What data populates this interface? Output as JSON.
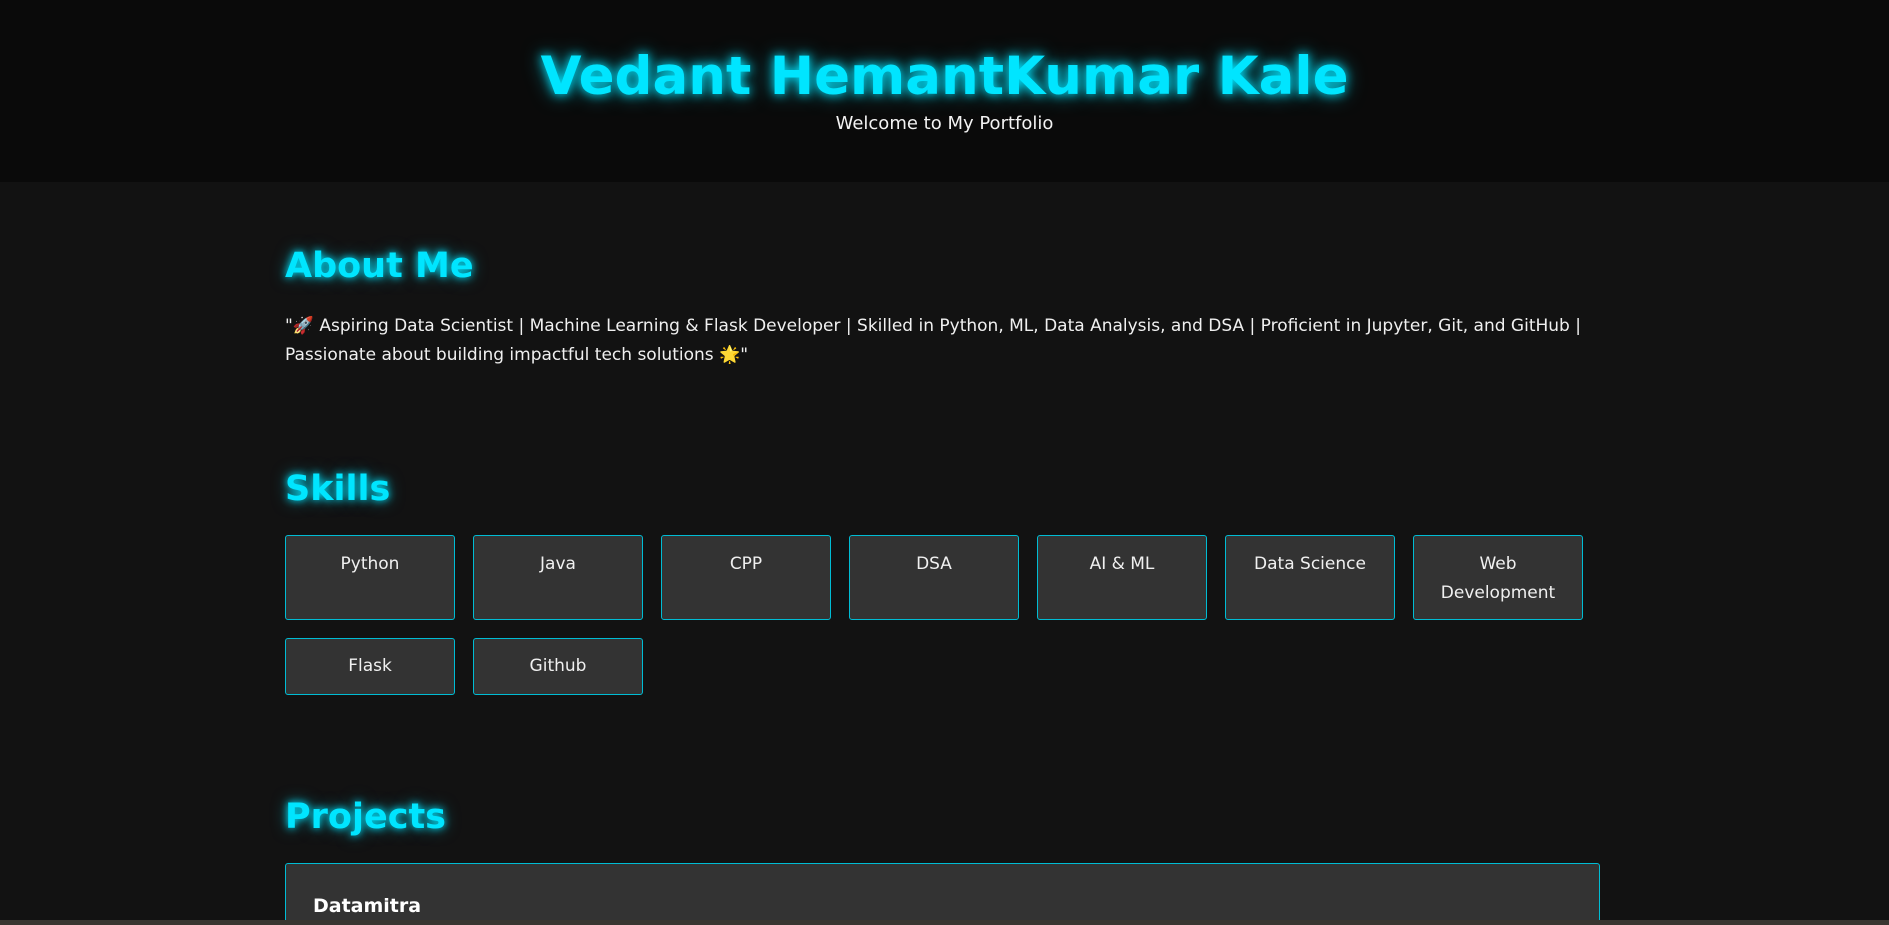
{
  "header": {
    "title": "Vedant HemantKumar Kale",
    "subtitle": "Welcome to My Portfolio"
  },
  "about": {
    "heading": "About Me",
    "text": "\"🚀 Aspiring Data Scientist | Machine Learning & Flask Developer | Skilled in Python, ML, Data Analysis, and DSA | Proficient in Jupyter, Git, and GitHub | Passionate about building impactful tech solutions 🌟\""
  },
  "skills": {
    "heading": "Skills",
    "items": [
      "Python",
      "Java",
      "CPP",
      "DSA",
      "AI & ML",
      "Data Science",
      "Web Development",
      "Flask",
      "Github"
    ]
  },
  "projects": {
    "heading": "Projects",
    "items": [
      {
        "title": "Datamitra"
      }
    ]
  },
  "colors": {
    "accent": "#00e5ff",
    "background": "#121212",
    "header_background": "#0a0a0a",
    "card_background": "#333333",
    "card_border": "#00bcd4"
  }
}
